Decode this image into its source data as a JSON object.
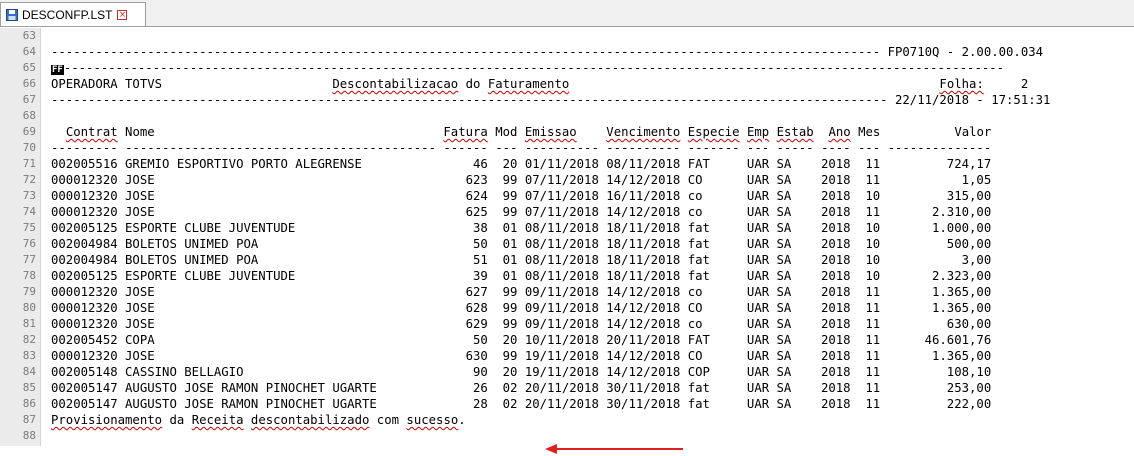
{
  "tab": {
    "title": "DESCONFP.LST",
    "close_glyph": "×"
  },
  "colors": {
    "arrow": "#e02020",
    "squiggle": "#c00000"
  },
  "lines": [
    {
      "n": "63",
      "text": ""
    },
    {
      "n": "64",
      "text": "---------------------------------------------------------------------------------------------------------------- FP0710Q - 2.00.00.034"
    },
    {
      "n": "65",
      "ff": "FF",
      "text": "-------------------------------------------------------------------------------------------------------------------------------"
    },
    {
      "n": "66",
      "text": "OPERADORA TOTVS                       Descontabilizacao do Faturamento                                                  Folha:     2"
    },
    {
      "n": "67",
      "text": "----------------------------------------------------------------------------------------------------------------- 22/11/2018 - 17:51:31"
    },
    {
      "n": "68",
      "text": ""
    },
    {
      "n": "69",
      "text": "  Contrat Nome                                       Fatura Mod Emissao    Vencimento Especie Emp Estab  Ano Mes          Valor"
    },
    {
      "n": "70",
      "text": "--------- ------------------------------------------ ------ --- ---------- ---------- ------- --- ----- ---- --- --------------"
    },
    {
      "n": "71",
      "text": "002005516 GREMIO ESPORTIVO PORTO ALEGRENSE               46  20 01/11/2018 08/11/2018 FAT     UAR SA    2018  11         724,17"
    },
    {
      "n": "72",
      "text": "000012320 JOSE                                          623  99 07/11/2018 14/12/2018 CO      UAR SA    2018  11           1,05"
    },
    {
      "n": "73",
      "text": "000012320 JOSE                                          624  99 07/11/2018 16/11/2018 co      UAR SA    2018  10         315,00"
    },
    {
      "n": "74",
      "text": "000012320 JOSE                                          625  99 07/11/2018 14/12/2018 co      UAR SA    2018  11       2.310,00"
    },
    {
      "n": "75",
      "text": "002005125 ESPORTE CLUBE JUVENTUDE                        38  01 08/11/2018 18/11/2018 fat     UAR SA    2018  10       1.000,00"
    },
    {
      "n": "76",
      "text": "002004984 BOLETOS UNIMED POA                             50  01 08/11/2018 18/11/2018 fat     UAR SA    2018  10         500,00"
    },
    {
      "n": "77",
      "text": "002004984 BOLETOS UNIMED POA                             51  01 08/11/2018 18/11/2018 fat     UAR SA    2018  10           3,00"
    },
    {
      "n": "78",
      "text": "002005125 ESPORTE CLUBE JUVENTUDE                        39  01 08/11/2018 18/11/2018 fat     UAR SA    2018  10       2.323,00"
    },
    {
      "n": "79",
      "text": "000012320 JOSE                                          627  99 09/11/2018 14/12/2018 co      UAR SA    2018  11       1.365,00"
    },
    {
      "n": "80",
      "text": "000012320 JOSE                                          628  99 09/11/2018 14/12/2018 CO      UAR SA    2018  11       1.365,00"
    },
    {
      "n": "81",
      "text": "000012320 JOSE                                          629  99 09/11/2018 14/12/2018 co      UAR SA    2018  11         630,00"
    },
    {
      "n": "82",
      "text": "002005452 COPA                                           50  20 10/11/2018 20/11/2018 FAT     UAR SA    2018  11      46.601,76"
    },
    {
      "n": "83",
      "text": "000012320 JOSE                                          630  99 19/11/2018 14/12/2018 CO      UAR SA    2018  11       1.365,00"
    },
    {
      "n": "84",
      "text": "002005148 CASSINO BELLAGIO                               90  20 19/11/2018 14/12/2018 COP     UAR SA    2018  11         108,10"
    },
    {
      "n": "85",
      "text": "002005147 AUGUSTO JOSE RAMON PINOCHET UGARTE             26  02 20/11/2018 30/11/2018 fat     UAR SA    2018  11         253,00"
    },
    {
      "n": "86",
      "text": "002005147 AUGUSTO JOSE RAMON PINOCHET UGARTE             28  02 20/11/2018 30/11/2018 fat     UAR SA    2018  11         222,00"
    },
    {
      "n": "87",
      "text": "Provisionamento da Receita descontabilizado com sucesso."
    },
    {
      "n": "88",
      "text": ""
    }
  ]
}
